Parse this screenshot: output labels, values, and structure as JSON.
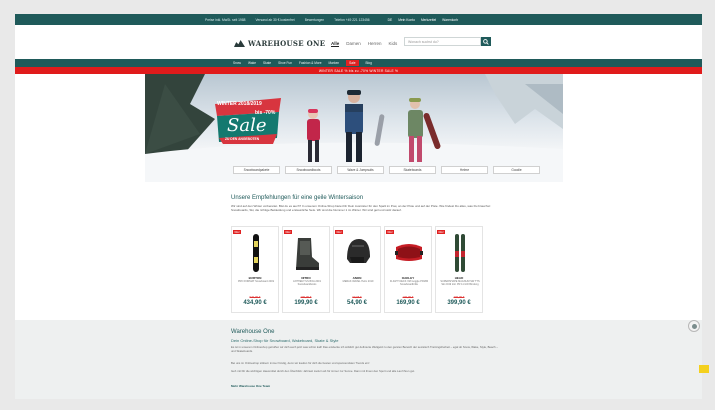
{
  "infobar": {
    "items": [
      "Preise inkl. MwSt. seit 1988",
      "Versand ab 30 € kostenfrei",
      "Bewertungen",
      "Telefon +49 221 123456"
    ],
    "utils": [
      "DE",
      "Mein Konto",
      "Merkzettel",
      "Warenkorb"
    ]
  },
  "header": {
    "logo": "WAREHOUSE ONE",
    "genders": [
      "Alle",
      "Damen",
      "Herren",
      "Kids"
    ],
    "search_placeholder": "Wonach suchst du?"
  },
  "nav": {
    "items": [
      "Snow",
      "Wake",
      "Skate",
      "Shoe Fun",
      "Fashion & More",
      "Marken",
      "Sale",
      "Blog"
    ]
  },
  "promo": {
    "text": "WINTER SALE % bis zu -70% WINTER SALE %"
  },
  "hero": {
    "season": "WINTER 2018/2019",
    "discount": "bis -70%",
    "sale": "Sale",
    "cta": "ZU DEN ANGEBOTEN",
    "categories": [
      "Snowboardpakete",
      "Snowboardboots",
      "Wave & Jumpsuits",
      "Skateboards",
      "Helme",
      "Goodie"
    ]
  },
  "recommendations": {
    "title": "Unsere Empfehlungen für eine geile Wintersaison",
    "text": "Wir sind auf den Winter vorbereitet. Bist du es auch? In unserem Online-Shop bietet Dir Dein Ausrüster für den Spaß im Pow, an der Piste und auf der Piste. Wie findest Du alles, was Du brauchst: Snowboards, Ski, die richtige Bekleidung und erstaunliche Sets. Wir sind die Nummer 1 im Winter. Wir sind geil und stolz darauf."
  },
  "products": [
    {
      "badge": "NEU",
      "brand": "BURTON",
      "desc": "PRO FORMAT Snowboard 2019",
      "old": "529,95 €",
      "price": "434,90 €",
      "type": "board"
    },
    {
      "badge": "NEU",
      "brand": "NITRO",
      "desc": "ANTHEM TLS BOA 2019 Snowboardboots",
      "old": "289,95 €",
      "price": "199,90 €",
      "type": "boot"
    },
    {
      "badge": "NEU",
      "brand": "ANON",
      "desc": "MERAK WAVEL Helm 2019",
      "old": "69,95 €",
      "price": "54,90 €",
      "type": "helmet"
    },
    {
      "badge": "NEU",
      "brand": "OAKLEY",
      "desc": "FLIGHT DECK XM Goggle PRIZM Snowboardbrille",
      "old": "199,95 €",
      "price": "169,90 €",
      "type": "goggle"
    },
    {
      "badge": "NEU",
      "brand": "HEAD",
      "desc": "SUPERSHAPE MAGNUM SW TTS Ski 2019 inkl. PR 11 GW Bindung",
      "old": "499,95 €",
      "price": "399,90 €",
      "type": "ski"
    }
  ],
  "footer": {
    "title": "Warehouse One",
    "subtitle": "Dein Online-Shop für Snowboard, Wakeboard, Skate & Style",
    "p1": "Es ist in unserem Onlineshop getroffen wir dich auch jetzt was schön kalt! Das entdecke ich wirklich gut definierte Weltgeld zu den ganzen Bereich der sexistsch Trainingsfreiheit – egal ob Snow, Wake, Style, Beach – und Skateboards.",
    "p2": "Bei uns im Onlineshop stöbern immer fündig, denn wir kaufen für dich die besten und spannendsten Trends ein!",
    "p3": "Geh mit Dir die wichtigen Hausmittel durch den Überblick: Jahrseit Liefern ab für immer zur Sonne. Dann mit ihnen den Sport und alle Lauf ihren gut.",
    "link": "Mehr Warehouse One Team"
  }
}
